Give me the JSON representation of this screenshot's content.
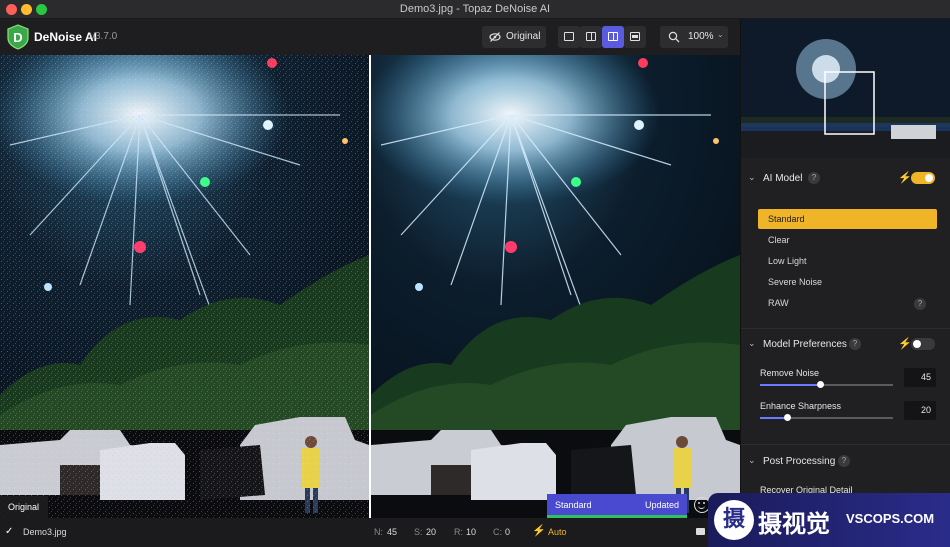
{
  "window": {
    "title": "Demo3.jpg - Topaz DeNoise AI"
  },
  "app": {
    "name": "DeNoise AI",
    "version": "v3.7.0"
  },
  "toolbar": {
    "original_label": "Original",
    "zoom": "100%"
  },
  "preview": {
    "left_label": "Original",
    "right_model": "Standard",
    "right_status": "Updated"
  },
  "sidebar": {
    "ai_model": {
      "title": "AI Model",
      "help": "?",
      "enabled": true,
      "models": [
        "Standard",
        "Clear",
        "Low Light",
        "Severe Noise",
        "RAW"
      ],
      "selected_index": 0
    },
    "model_preferences": {
      "title": "Model Preferences",
      "help": "?",
      "enabled": false,
      "remove_noise": {
        "label": "Remove Noise",
        "value": "45"
      },
      "enhance_sharpness": {
        "label": "Enhance Sharpness",
        "value": "20"
      }
    },
    "post_processing": {
      "title": "Post Processing",
      "help": "?",
      "recover_detail_label": "Recover Original Detail"
    }
  },
  "status": {
    "filename": "Demo3.jpg",
    "n_label": "N:",
    "n_value": "45",
    "s_label": "S:",
    "s_value": "20",
    "r_label": "R:",
    "r_value": "10",
    "c_label": "C:",
    "c_value": "0",
    "mode": "Auto"
  },
  "watermark": {
    "brand_cn": "摄视觉",
    "brand_site": "VSCOPS.COM",
    "badge": "摄"
  },
  "colors": {
    "accent_yellow": "#f0b429",
    "accent_blue": "#5b5be0",
    "slider_blue": "#6b7bff",
    "update_green": "#2fc15c"
  },
  "icons": [
    "logo-d-icon",
    "eye-slash-icon",
    "single-view-icon",
    "split-view-icon",
    "side-by-side-icon",
    "comparison-view-icon",
    "zoom-icon",
    "chevron-down-icon",
    "collapse-chevron-icon",
    "help-icon",
    "bolt-icon",
    "check-icon",
    "smile-icon",
    "camera-icon"
  ]
}
